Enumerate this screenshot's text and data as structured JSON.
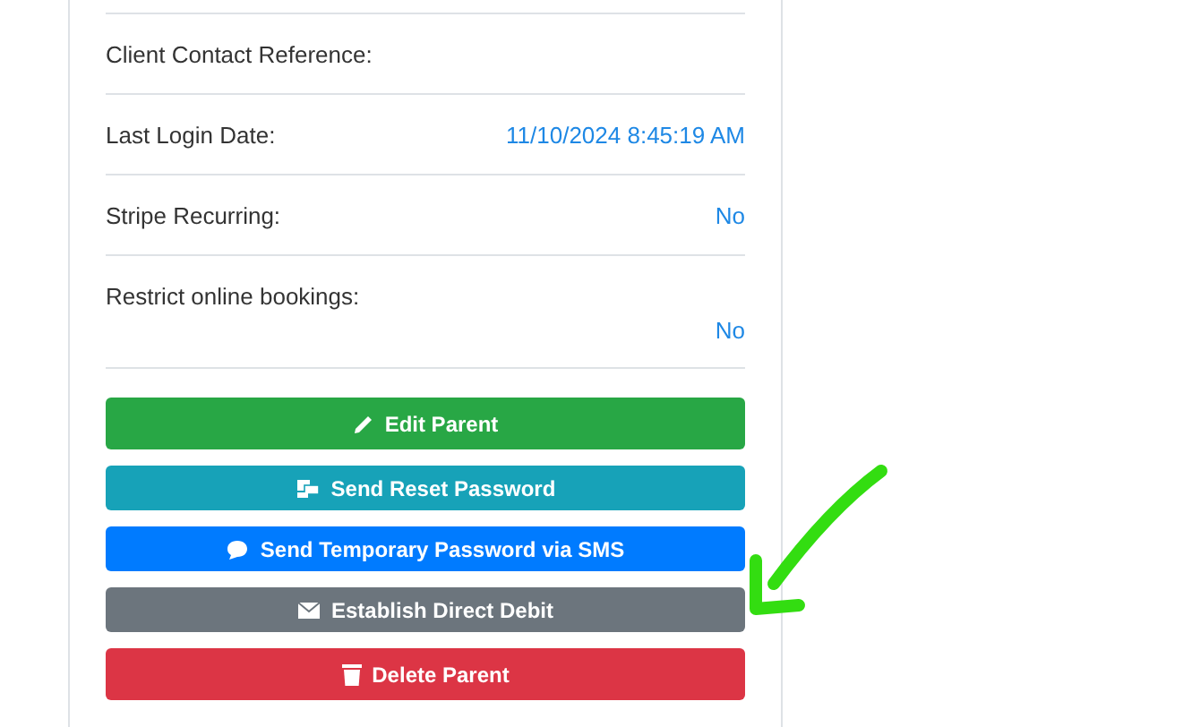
{
  "details": [
    {
      "label": "Client Contact Reference:",
      "kind": "inline"
    },
    {
      "label": "Last Login Date:",
      "value": "11/10/2024 8:45:19 AM",
      "kind": "inline"
    },
    {
      "label": "Stripe Recurring:",
      "value": "No",
      "kind": "inline"
    },
    {
      "label": "Restrict online bookings:",
      "value": "No",
      "kind": "stacked"
    }
  ],
  "buttons": [
    {
      "label": "Edit Parent",
      "kind": "success"
    },
    {
      "label": "Send Reset Password",
      "kind": "info"
    },
    {
      "label": "Send Temporary Password via SMS",
      "kind": "primary"
    },
    {
      "label": "Establish Direct Debit",
      "kind": "secondary"
    },
    {
      "label": "Delete Parent",
      "kind": "danger"
    }
  ]
}
